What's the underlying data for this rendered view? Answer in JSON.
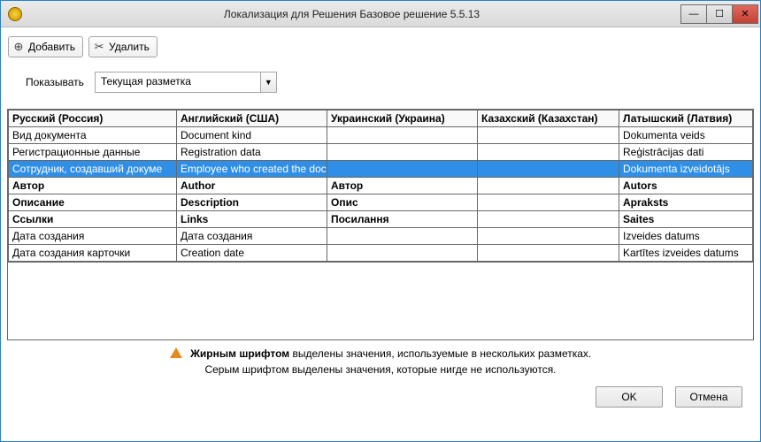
{
  "window": {
    "title": "Локализация для Решения Базовое решение 5.5.13"
  },
  "toolbar": {
    "add_label": "Добавить",
    "delete_label": "Удалить"
  },
  "filter": {
    "label": "Показывать",
    "selected": "Текущая разметка"
  },
  "grid": {
    "columns": [
      "Русский (Россия)",
      "Английский (США)",
      "Украинский (Украина)",
      "Казахский (Казахстан)",
      "Латышский (Латвия)"
    ],
    "rows": [
      {
        "bold": false,
        "selected": false,
        "cells": [
          "Вид документа",
          "Document kind",
          "",
          "",
          "Dokumenta veids"
        ]
      },
      {
        "bold": false,
        "selected": false,
        "cells": [
          "Регистрационные данные",
          "Registration data",
          "",
          "",
          "Reģistrācijas dati"
        ]
      },
      {
        "bold": false,
        "selected": true,
        "cells": [
          "Сотрудник, создавший докуме",
          "Employee who created the doc",
          "",
          "",
          "Dokumenta izveidotājs"
        ]
      },
      {
        "bold": true,
        "selected": false,
        "cells": [
          "Автор",
          "Author",
          "Автор",
          "",
          "Autors"
        ]
      },
      {
        "bold": true,
        "selected": false,
        "cells": [
          "Описание",
          "Description",
          "Опис",
          "",
          "Apraksts"
        ]
      },
      {
        "bold": true,
        "selected": false,
        "cells": [
          "Ссылки",
          "Links",
          "Посилання",
          "",
          "Saites"
        ]
      },
      {
        "bold": false,
        "selected": false,
        "cells": [
          "Дата создания",
          "Дата создания",
          "",
          "",
          "Izveides datums"
        ]
      },
      {
        "bold": false,
        "selected": false,
        "cells": [
          "Дата создания карточки",
          "Creation date",
          "",
          "",
          "Kartītes izveides datums"
        ]
      }
    ]
  },
  "info": {
    "line1_bold": "Жирным шрифтом",
    "line1_rest": " выделены значения, используемые в нескольких разметках.",
    "line2": "Серым шрифтом выделены значения, которые нигде не используются."
  },
  "footer": {
    "ok": "OK",
    "cancel": "Отмена"
  }
}
